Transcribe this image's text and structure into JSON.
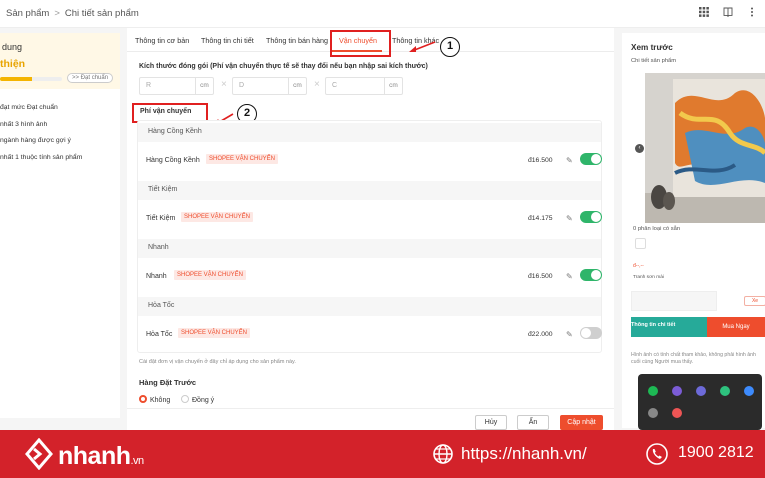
{
  "breadcrumb": {
    "parent": "Sản phẩm",
    "current": "Chi tiết sản phẩm"
  },
  "left_panel": {
    "title": "dung",
    "status": "thiện",
    "progress": 0.52,
    "chip": "Đạt chuẩn",
    "items": [
      "đạt mức Đạt chuẩn",
      "nhất 3 hình ảnh",
      "ngành hàng được gợi ý",
      "nhất 1 thuộc tính sản phẩm"
    ]
  },
  "tabs": [
    "Thông tin cơ bản",
    "Thông tin chi tiết",
    "Thông tin bán hàng",
    "Vận chuyển",
    "Thông tin khác"
  ],
  "active_tab": 3,
  "package": {
    "label": "Kích thước đóng gói (Phí vận chuyển thực tế sẽ thay đổi nếu bạn nhập sai kích thước)",
    "fields": [
      {
        "placeholder": "R",
        "unit": "cm"
      },
      {
        "placeholder": "D",
        "unit": "cm"
      },
      {
        "placeholder": "C",
        "unit": "cm"
      }
    ],
    "times": "×"
  },
  "shipping_fee_label": "Phí vận chuyển",
  "shipping_groups": [
    {
      "header": "Hàng Cồng Kềnh",
      "name": "Hàng Cồng Kềnh",
      "tag": "SHOPEE VẬN CHUYỂN",
      "price": "đ16.500",
      "enabled": true
    },
    {
      "header": "Tiết Kiệm",
      "name": "Tiết Kiệm",
      "tag": "SHOPEE VẬN CHUYỂN",
      "price": "đ14.175",
      "enabled": true
    },
    {
      "header": "Nhanh",
      "name": "Nhanh",
      "tag": "SHOPEE VẬN CHUYỂN",
      "price": "đ16.500",
      "enabled": true
    },
    {
      "header": "Hỏa Tốc",
      "name": "Hỏa Tốc",
      "tag": "SHOPEE VẬN CHUYỂN",
      "price": "đ22.000",
      "enabled": false
    }
  ],
  "note": "Cài đặt đơn vị vận chuyển ở đây chỉ áp dụng cho sản phẩm này.",
  "preorder": {
    "label": "Hàng Đặt Trước",
    "options": [
      "Không",
      "Đồng ý"
    ],
    "selected": 0
  },
  "footer": {
    "cancel": "Hủy",
    "hide": "Ẩn",
    "update": "Cập nhật"
  },
  "annotations": [
    "1",
    "2"
  ],
  "preview": {
    "title": "Xem trước",
    "subtitle": "Chi tiết sản phẩm",
    "classes": "0 phân loại có sẵn",
    "price_line": "đ--,--",
    "price_sub": "Tranh sơn mài",
    "chip": "Xe",
    "bar_left": "Thông tin chi tiết",
    "buy": "Mua Ngay",
    "footnote": "Hình ảnh có tính chất tham khảo, không phải hình ảnh cuối cùng Người mua thấy."
  },
  "banner": {
    "brand": "nhanh",
    "brand_suffix": ".vn",
    "url": "https://nhanh.vn/",
    "phone": "1900 2812"
  },
  "colors": {
    "accent": "#ee4d2d",
    "toggle_on": "#2fb56a",
    "banner": "#d3222a",
    "annotation": "#e02020"
  }
}
